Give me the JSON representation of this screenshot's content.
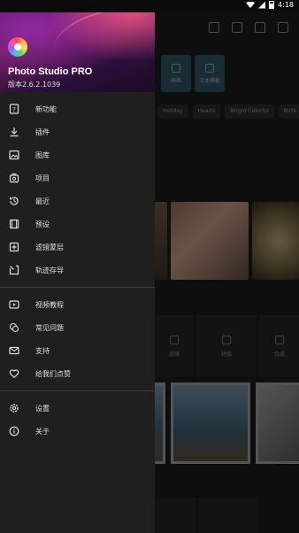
{
  "status_bar": {
    "time": "4:18"
  },
  "drawer": {
    "app_name": "Photo Studio PRO",
    "version": "版本2.6.2.1039",
    "section1": [
      {
        "label": "新功能",
        "icon": "new-features-icon"
      },
      {
        "label": "插件",
        "icon": "download-icon"
      },
      {
        "label": "图库",
        "icon": "gallery-icon"
      },
      {
        "label": "项目",
        "icon": "projects-icon"
      },
      {
        "label": "最近",
        "icon": "recent-icon"
      },
      {
        "label": "预设",
        "icon": "presets-icon"
      },
      {
        "label": "滤镜蒙层",
        "icon": "filter-overlay-icon"
      },
      {
        "label": "轨迹存导",
        "icon": "import-icon"
      }
    ],
    "section2": [
      {
        "label": "视频教程",
        "icon": "video-tutorial-icon"
      },
      {
        "label": "常见问题",
        "icon": "faq-icon"
      },
      {
        "label": "支持",
        "icon": "mail-icon"
      },
      {
        "label": "给我们点赞",
        "icon": "heart-icon"
      }
    ],
    "section3": [
      {
        "label": "设置",
        "icon": "settings-icon"
      },
      {
        "label": "关于",
        "icon": "info-icon"
      }
    ]
  },
  "background": {
    "tiles": [
      "画框",
      "文本模板"
    ],
    "chips": [
      "Holiday",
      "Hearts",
      "Bright Colorful",
      "Birth"
    ],
    "grid_labels": [
      "滤镜",
      "拼接",
      "合成"
    ]
  }
}
